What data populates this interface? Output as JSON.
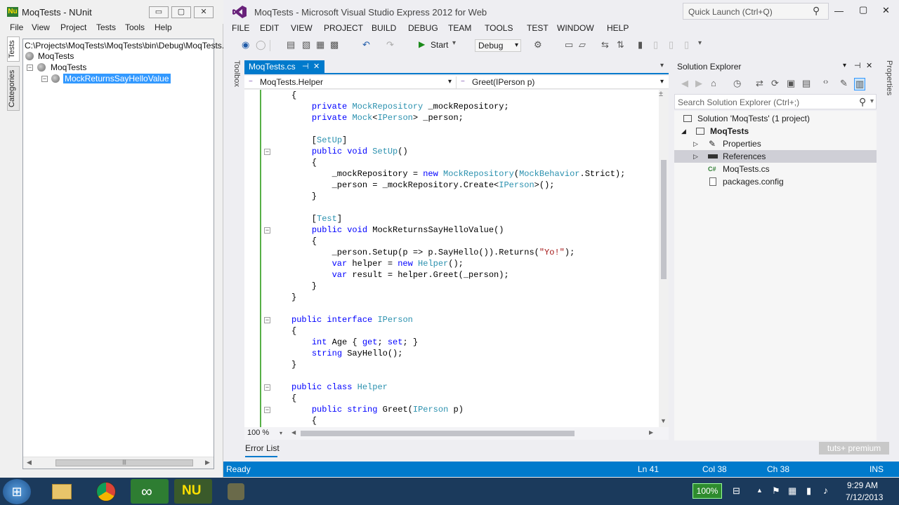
{
  "nunit": {
    "title": "MoqTests - NUnit",
    "window_buttons": {
      "minimize": "▭",
      "maximize": "▢",
      "close": "✕"
    },
    "menu": [
      "File",
      "View",
      "Project",
      "Tests",
      "Tools",
      "Help"
    ],
    "side_tabs": [
      "Tests",
      "Categories"
    ],
    "tree": {
      "root_path": "C:\\Projects\\MoqTests\\MoqTests\\bin\\Debug\\MoqTests.",
      "n1": "MoqTests",
      "n2": "MoqTests",
      "n3": "MockReturnsSayHelloValue"
    },
    "tree_minus": "−",
    "scroll_left": "◀",
    "scroll_right": "▶",
    "scroll_grip": "|||"
  },
  "vs": {
    "title": "MoqTests - Microsoft Visual Studio Express 2012 for Web",
    "quick_launch": "Quick Launch (Ctrl+Q)",
    "window_buttons": {
      "minimize": "—",
      "maximize": "▢",
      "close": "✕"
    },
    "menu": [
      "FILE",
      "EDIT",
      "VIEW",
      "PROJECT",
      "BUILD",
      "DEBUG",
      "TEAM",
      "TOOLS",
      "TEST",
      "WINDOW",
      "HELP"
    ],
    "toolbar": {
      "start": "Start",
      "config": "Debug"
    },
    "toolbox_label": "Toolbox",
    "doc_tab": {
      "label": "MoqTests.cs",
      "pin": "⊣",
      "close": "✕"
    },
    "nav": {
      "left": "MoqTests.Helper",
      "right": "Greet(IPerson p)"
    },
    "zoom": "100 %",
    "error_list": "Error List",
    "icons": {
      "search": "⚲",
      "dropdown": "▾",
      "play": "▶",
      "left": "◀",
      "right": "▶",
      "up": "▲",
      "down": "▼",
      "plus": "±",
      "collapse": "−"
    },
    "toolbar_glyphs": [
      "◉",
      "◯",
      "▤",
      "▧",
      "▦",
      "▩",
      "↶",
      "↷",
      "⚙",
      "▭",
      "▱",
      "⇆",
      "⇅",
      "▮",
      "▯",
      "▯",
      "▯",
      "▾"
    ],
    "se_toolbar_glyphs": [
      "◀",
      "▶",
      "⌂",
      "◷",
      "⇄",
      "⟳",
      "▣",
      "▤",
      "‹›",
      "✎",
      "▥"
    ]
  },
  "code_lines": [
    "{",
    "    private MockRepository _mockRepository;",
    "    private Mock<IPerson> _person;",
    "",
    "    [SetUp]",
    "    public void SetUp()",
    "    {",
    "        _mockRepository = new MockRepository(MockBehavior.Strict);",
    "        _person = _mockRepository.Create<IPerson>();",
    "    }",
    "",
    "    [Test]",
    "    public void MockReturnsSayHelloValue()",
    "    {",
    "        _person.Setup(p => p.SayHello()).Returns(\"Yo!\");",
    "        var helper = new Helper();",
    "        var result = helper.Greet(_person);",
    "    }",
    "}",
    "",
    "public interface IPerson",
    "{",
    "    int Age { get; set; }",
    "    string SayHello();",
    "}",
    "",
    "public class Helper",
    "{",
    "    public string Greet(IPerson p)",
    "    {"
  ],
  "solution_explorer": {
    "title": "Solution Explorer",
    "header_buttons": {
      "dropdown": "▾",
      "pin": "⊣",
      "close": "✕"
    },
    "search_placeholder": "Search Solution Explorer (Ctrl+;)",
    "nodes": {
      "solution": "Solution 'MoqTests' (1 project)",
      "project": "MoqTests",
      "properties": "Properties",
      "references": "References",
      "file": "MoqTests.cs",
      "config": "packages.config"
    },
    "arrows": {
      "expanded": "◢",
      "collapsed": "▷"
    },
    "file_badge": "C#",
    "properties_tab": "Properties"
  },
  "status": {
    "ready": "Ready",
    "ln": "Ln 41",
    "col": "Col 38",
    "ch": "Ch 38",
    "mode": "INS"
  },
  "watermark": "tuts+ premium",
  "taskbar": {
    "start_icon": "⊞",
    "nunit_icon": "NU",
    "vs_icon": "∞",
    "battery": "100%",
    "tray_glyphs": [
      "⊟",
      "▲",
      "⚑",
      "▦",
      "▮",
      "♪"
    ],
    "time": "9:29 AM",
    "date": "7/12/2013"
  }
}
